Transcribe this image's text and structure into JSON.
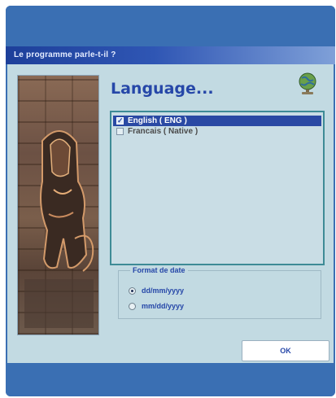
{
  "window": {
    "title": "Le programme parle-t-il ?"
  },
  "dialog": {
    "heading": "Language...",
    "languages": [
      {
        "label": "English ( ENG )",
        "selected": true,
        "checked": true
      },
      {
        "label": "Francais ( Native )",
        "selected": false,
        "checked": false
      }
    ],
    "date_format": {
      "label": "Format de date",
      "options": [
        {
          "label": "dd/mm/yyyy",
          "checked": true
        },
        {
          "label": "mm/dd/yyyy",
          "checked": false
        }
      ]
    },
    "ok_label": "OK"
  },
  "icons": {
    "globe": "globe-icon",
    "check": "checkbox-icon"
  },
  "colors": {
    "frame": "#3a6fb3",
    "dialog_bg": "#c2dae2",
    "accent": "#2647a8",
    "selection": "#2a49a4"
  }
}
